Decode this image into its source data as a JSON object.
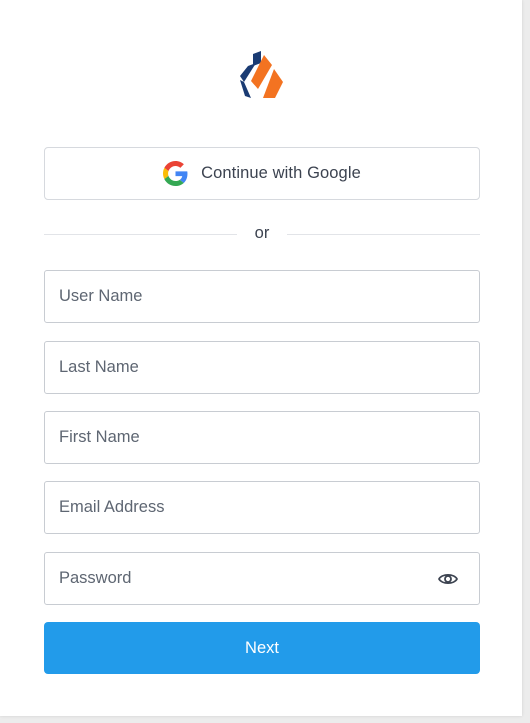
{
  "logo": {
    "icon": "brand-logo-icon",
    "colors": [
      "#1a3b73",
      "#f37321"
    ]
  },
  "google_button": {
    "label": "Continue with Google",
    "icon": "google-icon"
  },
  "divider": {
    "text": "or"
  },
  "form": {
    "fields": [
      {
        "placeholder": "User Name",
        "value": ""
      },
      {
        "placeholder": "Last Name",
        "value": ""
      },
      {
        "placeholder": "First Name",
        "value": ""
      },
      {
        "placeholder": "Email Address",
        "value": ""
      },
      {
        "placeholder": "Password",
        "value": "",
        "icon": "eye-icon"
      }
    ],
    "submit_label": "Next"
  },
  "colors": {
    "primary": "#229bea",
    "text": "#3c4350",
    "border": "#c8ccd2"
  }
}
